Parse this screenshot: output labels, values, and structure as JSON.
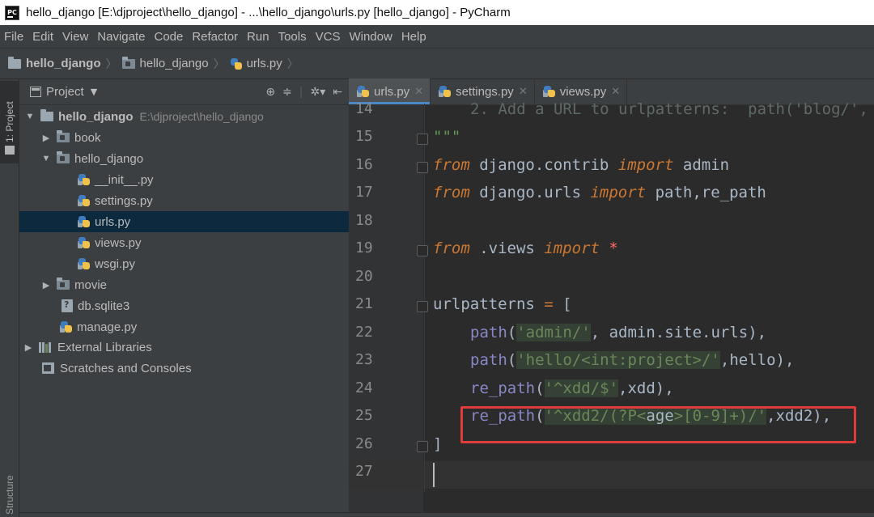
{
  "window": {
    "title": "hello_django [E:\\djproject\\hello_django] - ...\\hello_django\\urls.py [hello_django] - PyCharm",
    "app_icon": "PC"
  },
  "menu": [
    "File",
    "Edit",
    "View",
    "Navigate",
    "Code",
    "Refactor",
    "Run",
    "Tools",
    "VCS",
    "Window",
    "Help"
  ],
  "breadcrumb": [
    "hello_django",
    "hello_django",
    "urls.py"
  ],
  "side_tabs": {
    "project": "1: Project",
    "structure": "Structure"
  },
  "project": {
    "title": "Project",
    "tree": [
      {
        "label": "hello_django",
        "path": "E:\\djproject\\hello_django",
        "type": "folder",
        "expanded": true
      },
      {
        "label": "book",
        "type": "folder",
        "expanded": false
      },
      {
        "label": "hello_django",
        "type": "folder",
        "expanded": true
      },
      {
        "label": "__init__.py",
        "type": "python"
      },
      {
        "label": "settings.py",
        "type": "python"
      },
      {
        "label": "urls.py",
        "type": "python",
        "selected": true
      },
      {
        "label": "views.py",
        "type": "python"
      },
      {
        "label": "wsgi.py",
        "type": "python"
      },
      {
        "label": "movie",
        "type": "folder",
        "expanded": false
      },
      {
        "label": "db.sqlite3",
        "type": "unknown"
      },
      {
        "label": "manage.py",
        "type": "python"
      },
      {
        "label": "External Libraries",
        "type": "library",
        "expanded": false
      },
      {
        "label": "Scratches and Consoles",
        "type": "scratch"
      }
    ]
  },
  "tabs": [
    {
      "label": "urls.py",
      "active": true
    },
    {
      "label": "settings.py",
      "active": false
    },
    {
      "label": "views.py",
      "active": false
    }
  ],
  "editor": {
    "line_numbers": [
      "14",
      "15",
      "16",
      "17",
      "18",
      "19",
      "20",
      "21",
      "22",
      "23",
      "24",
      "25",
      "26",
      "27"
    ],
    "highlighted_line": "25",
    "current_line": "27"
  },
  "colors": {
    "accent": "#4a88c7",
    "highlight_box": "#e03c3c",
    "selection": "#0d293e"
  }
}
